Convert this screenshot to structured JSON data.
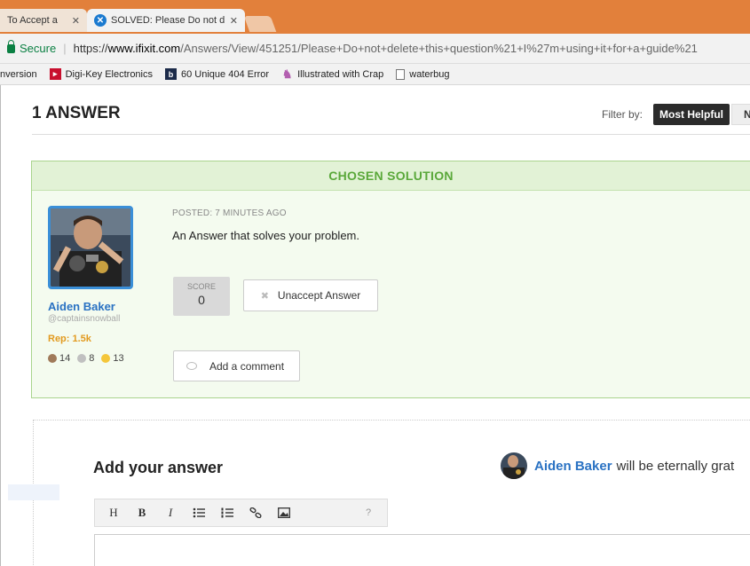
{
  "browser": {
    "tabs": [
      {
        "label": "To Accept a",
        "active": false
      },
      {
        "label": "SOLVED: Please Do not d",
        "active": true
      }
    ],
    "address": {
      "secure_label": "Secure",
      "url_scheme": "https://",
      "url_domain": "www.ifixit.com",
      "url_path": "/Answers/View/451251/Please+Do+not+delete+this+question%21+I%27m+using+it+for+a+guide%21"
    },
    "bookmarks": [
      {
        "label": "nversion",
        "icon": "none"
      },
      {
        "label": "Digi-Key Electronics",
        "icon": "digikey-icon"
      },
      {
        "label": "60 Unique 404 Error",
        "icon": "behance-icon"
      },
      {
        "label": "Illustrated with Crap",
        "icon": "illustration-icon"
      },
      {
        "label": "waterbug",
        "icon": "document-icon"
      }
    ]
  },
  "answers": {
    "title": "1 ANSWER",
    "filter_label": "Filter by:",
    "filter_selected": "Most Helpful",
    "filter_next": "N"
  },
  "solution": {
    "header": "CHOSEN SOLUTION",
    "posted": "POSTED: 7 MINUTES AGO",
    "text": "An Answer that solves your problem.",
    "score_label": "SCORE",
    "score_value": "0",
    "unaccept_label": "Unaccept Answer",
    "comment_label": "Add a comment",
    "user": {
      "name": "Aiden Baker",
      "handle": "@captainsnowball",
      "rep": "Rep: 1.5k",
      "badges": {
        "bronze": "14",
        "silver": "8",
        "gold": "13"
      }
    }
  },
  "add_answer": {
    "title": "Add your answer",
    "grateful_name": "Aiden Baker",
    "grateful_text": "will be eternally grat"
  },
  "editor_toolbar": [
    {
      "label": "H",
      "name": "heading-button"
    },
    {
      "label": "B",
      "name": "bold-button"
    },
    {
      "label": "I",
      "name": "italic-button"
    }
  ],
  "colors": {
    "tabbar": "#e2803b",
    "solution_green": "#5aa83a",
    "link_blue": "#2a72c3",
    "rep_orange": "#e29a1f"
  }
}
